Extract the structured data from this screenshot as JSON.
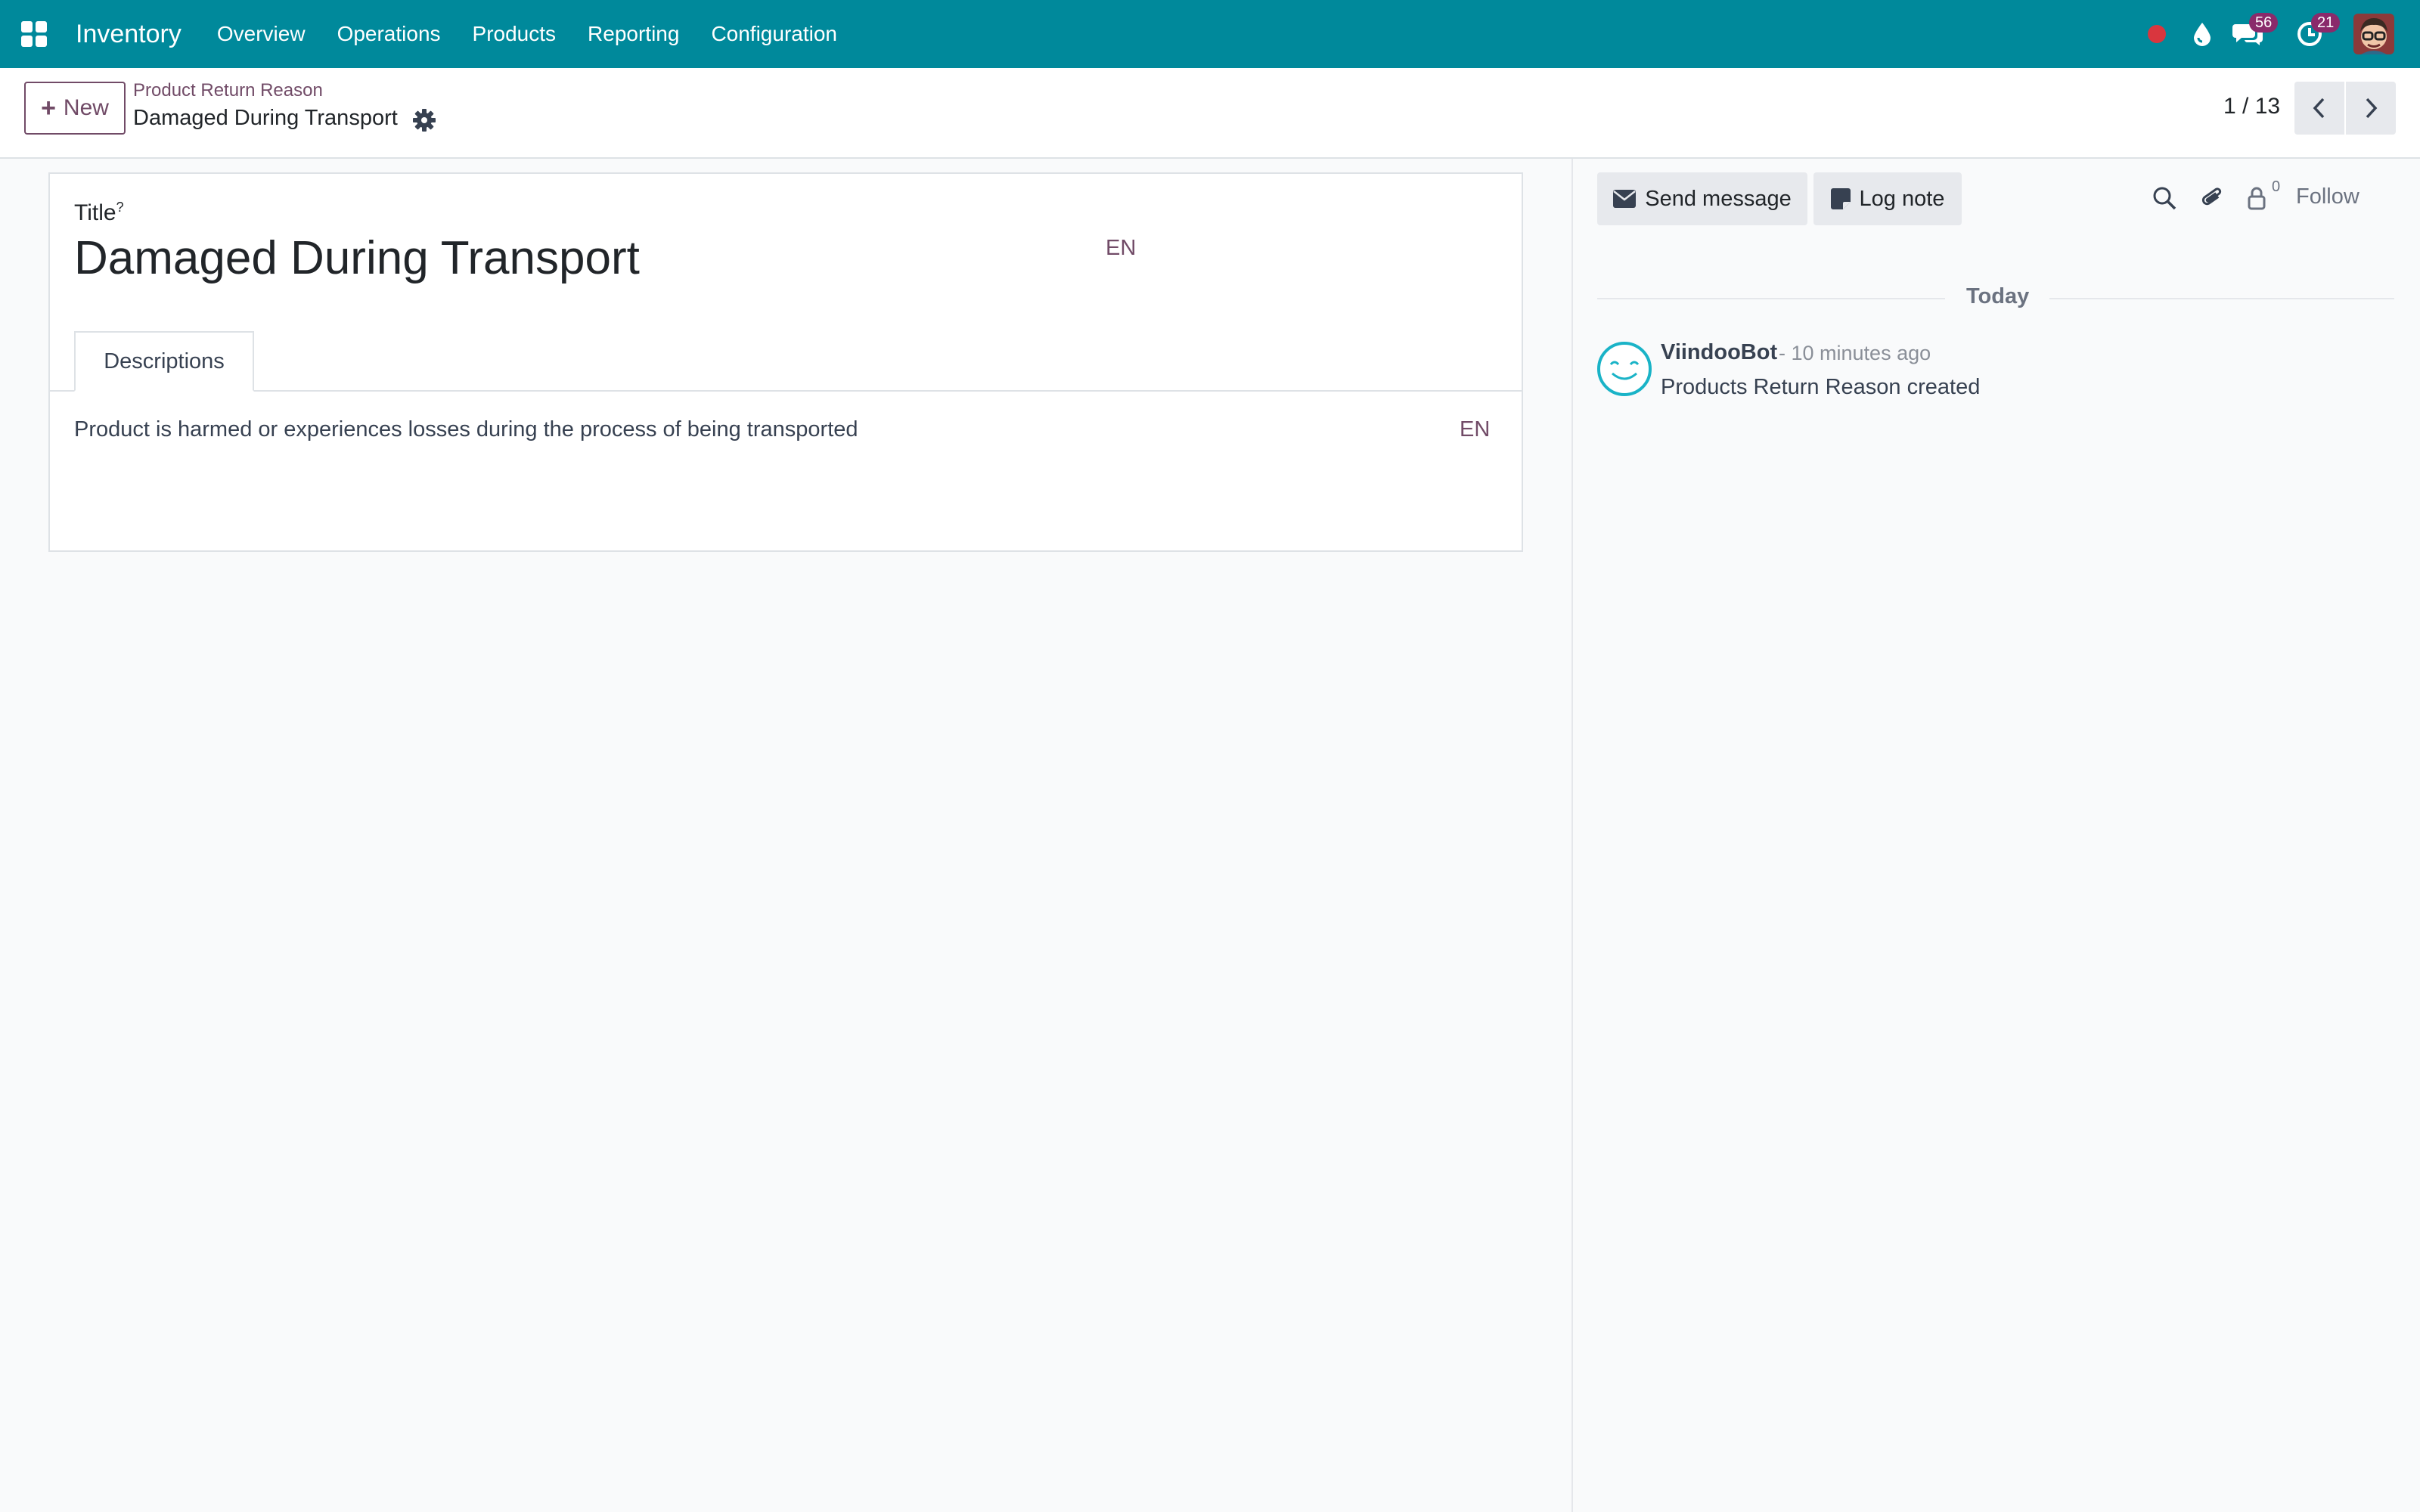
{
  "navbar": {
    "app_name": "Inventory",
    "menu": [
      "Overview",
      "Operations",
      "Products",
      "Reporting",
      "Configuration"
    ],
    "messages_badge": "56",
    "activities_badge": "21",
    "colors": {
      "bar": "#00899b",
      "badge": "#8a2a6b",
      "record_dot": "#d9363e"
    }
  },
  "control_panel": {
    "new_label": "New",
    "breadcrumb_parent": "Product Return Reason",
    "breadcrumb_current": "Damaged During Transport",
    "pager": "1 / 13"
  },
  "form": {
    "title_label": "Title",
    "title_help": "?",
    "title_value": "Damaged During Transport",
    "title_lang": "EN",
    "tab_label": "Descriptions",
    "description": "Product is harmed or experiences losses during the process of being transported",
    "description_lang": "EN"
  },
  "chatter": {
    "send_message": "Send message",
    "log_note": "Log note",
    "follower_count": "0",
    "follow": "Follow",
    "date_separator": "Today",
    "messages": [
      {
        "author": "ViindooBot",
        "time": "- 10 minutes ago",
        "body": "Products Return Reason created"
      }
    ]
  }
}
